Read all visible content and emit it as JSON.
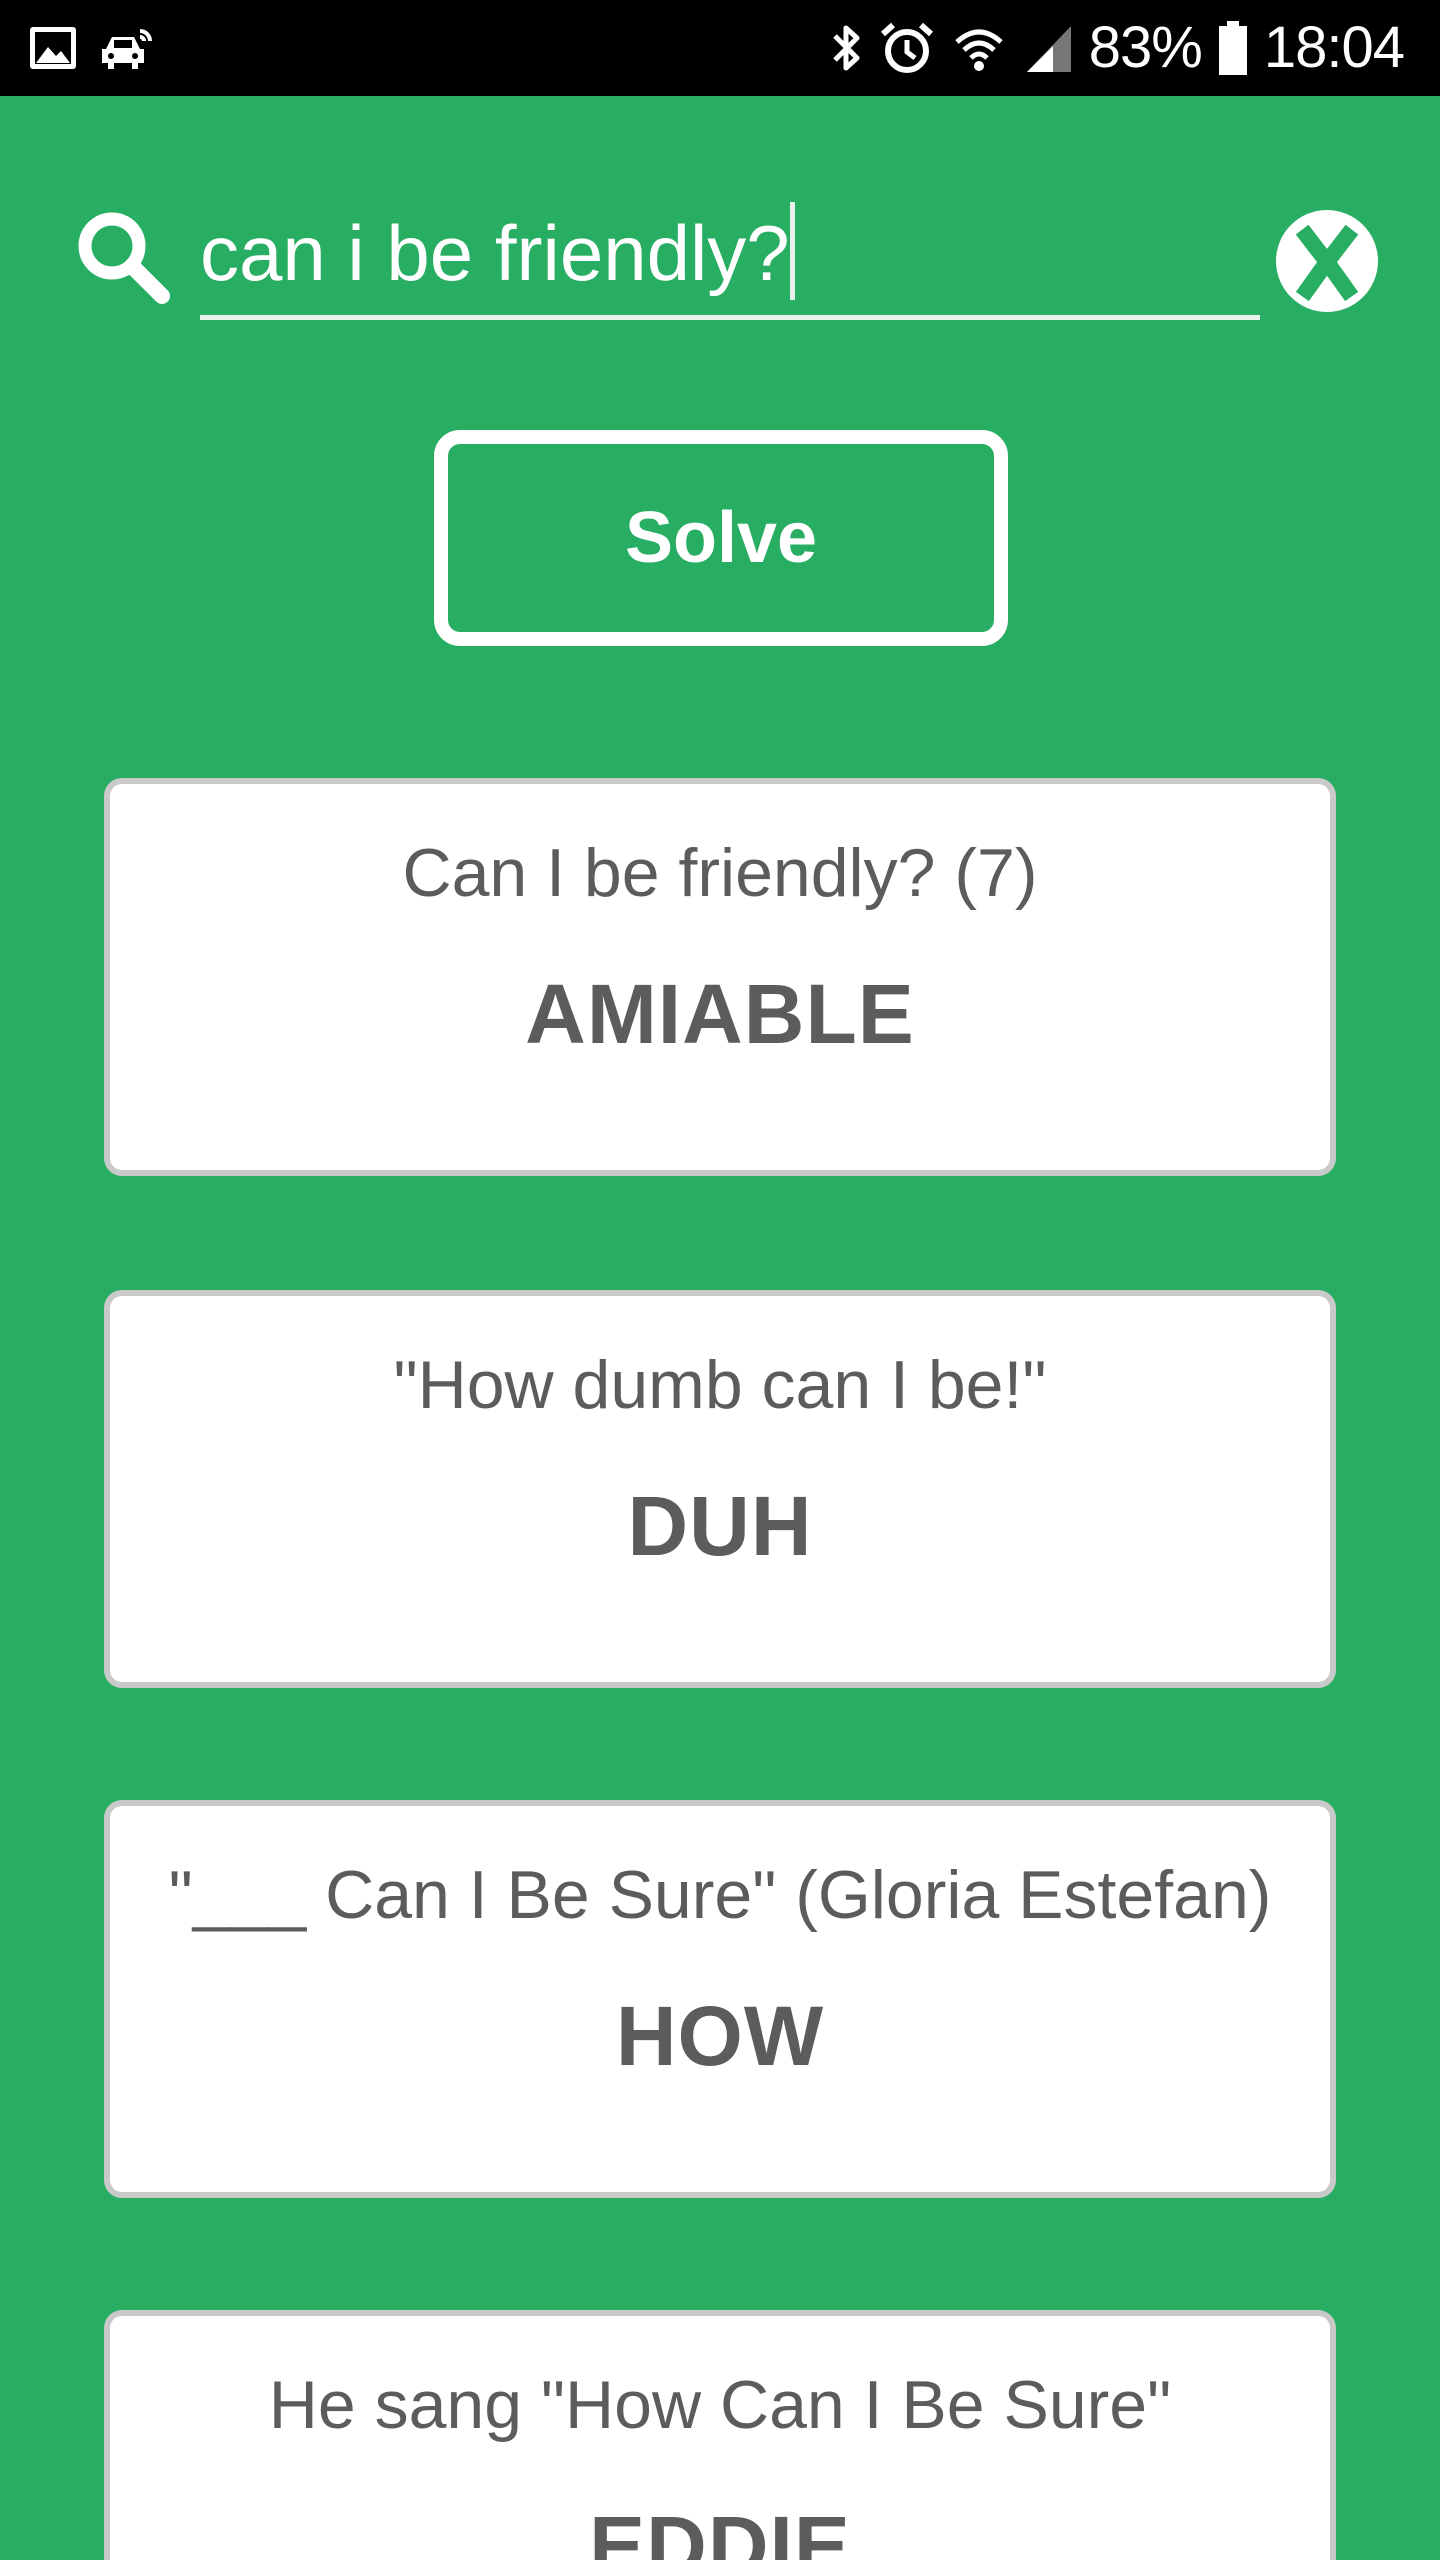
{
  "status_bar": {
    "left_icons": [
      "image-icon",
      "car-notification-icon"
    ],
    "right_icons": [
      "bluetooth-icon",
      "alarm-icon",
      "wifi-icon",
      "signal-icon"
    ],
    "battery_percent": "83%",
    "battery_icon": "battery-icon",
    "time": "18:04"
  },
  "search": {
    "icon": "search-icon",
    "value": "can i be friendly?",
    "clear_icon": "close-icon"
  },
  "solve_button": {
    "label": "Solve"
  },
  "results": [
    {
      "clue": "Can I be friendly? (7)",
      "answer": "AMIABLE"
    },
    {
      "clue": "\"How dumb can I be!\"",
      "answer": "DUH"
    },
    {
      "clue": "\"___ Can I Be Sure\" (Gloria Estefan)",
      "answer": "HOW"
    },
    {
      "clue": "He sang \"How Can I Be Sure\"",
      "answer": "EDDIE"
    }
  ],
  "colors": {
    "background": "#28AE63",
    "card_text": "#5C5C5C",
    "card_border": "#C9C9C9",
    "status_bar": "#000000"
  }
}
